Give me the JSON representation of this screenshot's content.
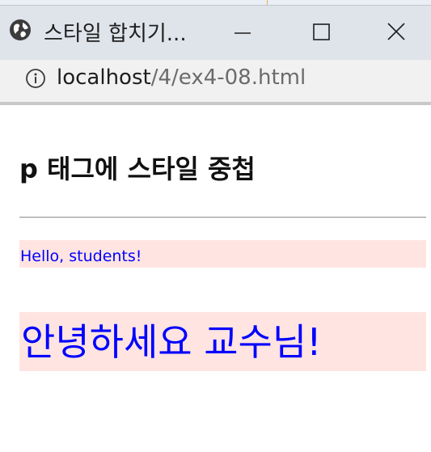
{
  "window": {
    "tab_title": "스타일 합치기...",
    "favicon": "globe-icon",
    "controls": {
      "minimize": "minimize-icon",
      "maximize": "maximize-icon",
      "close": "close-icon"
    }
  },
  "address_bar": {
    "info_icon": "info-icon",
    "host": "localhost",
    "path": "/4/ex4-08.html"
  },
  "page": {
    "heading": "p 태그에 스타일 중첩",
    "paragraph_small": "Hello, students!",
    "paragraph_large": "안녕하세요 교수님!"
  },
  "colors": {
    "paragraph_background": "#ffe4e1",
    "paragraph_text": "#0000ff"
  }
}
